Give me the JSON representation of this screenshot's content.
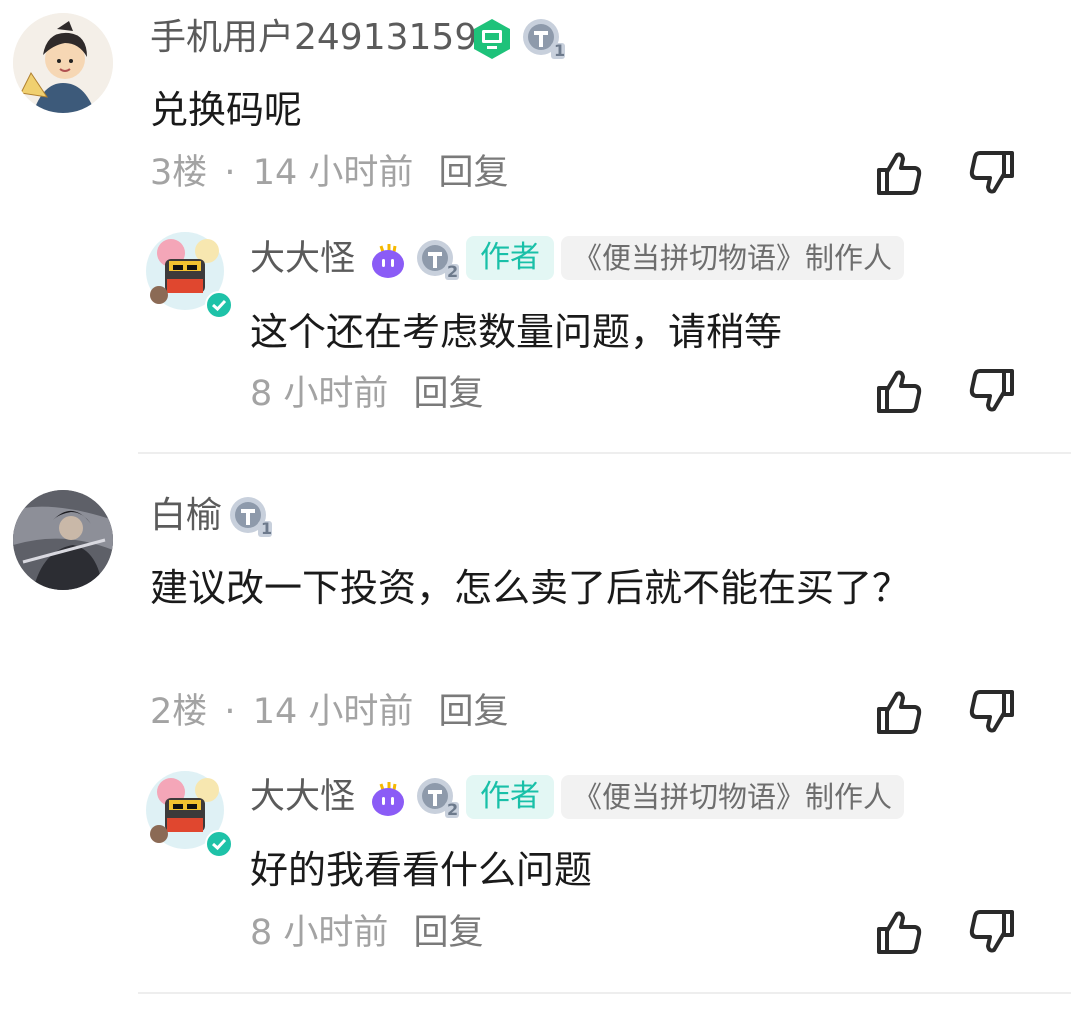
{
  "comments": [
    {
      "username": "手机用户24913159",
      "level": "1",
      "text": "兑换码呢",
      "floor": "3楼",
      "sep": "·",
      "time": "14 小时前",
      "reply_label": "回复",
      "reply": {
        "username": "大大怪",
        "level": "2",
        "author_badge": "作者",
        "role_badge": "《便当拼切物语》制作人",
        "text": "这个还在考虑数量问题，请稍等",
        "time": "8 小时前",
        "reply_label": "回复"
      }
    },
    {
      "username": "白榆",
      "level": "1",
      "text": "建议改一下投资，怎么卖了后就不能在买了？",
      "floor": "2楼",
      "sep": "·",
      "time": "14 小时前",
      "reply_label": "回复",
      "reply": {
        "username": "大大怪",
        "level": "2",
        "author_badge": "作者",
        "role_badge": "《便当拼切物语》制作人",
        "text": "好的我看看什么问题",
        "time": "8 小时前",
        "reply_label": "回复"
      }
    }
  ],
  "icons": {
    "like": "thumbs-up-icon",
    "dislike": "thumbs-down-icon",
    "device": "pc-device-icon",
    "level": "level-badge-icon",
    "fan": "fan-badge-icon",
    "verified": "verified-check-icon"
  },
  "colors": {
    "accent": "#19c0a8",
    "meta": "#a3a3a3",
    "name": "#5b5b5b",
    "device_green": "#1ec27a",
    "fan_purple": "#8b5cf6"
  }
}
